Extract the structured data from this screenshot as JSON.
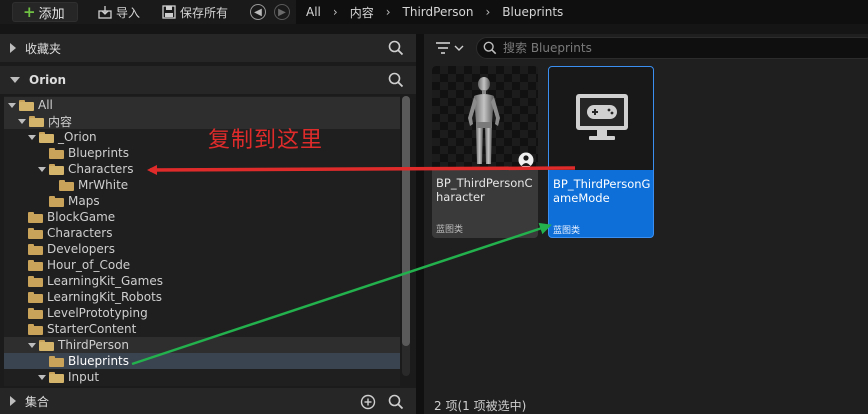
{
  "toolbar": {
    "add_label": "添加",
    "import_label": "导入",
    "save_all_label": "保存所有"
  },
  "breadcrumb": [
    "All",
    "内容",
    "ThirdPerson",
    "Blueprints"
  ],
  "left_panel": {
    "favorites_label": "收藏夹",
    "project_label": "Orion",
    "collections_label": "集合",
    "tree": [
      {
        "label": "All",
        "depth": 0,
        "expanded": true,
        "state": "parent"
      },
      {
        "label": "内容",
        "depth": 1,
        "expanded": true,
        "state": "parent"
      },
      {
        "label": "_Orion",
        "depth": 2,
        "expanded": true,
        "state": ""
      },
      {
        "label": "Blueprints",
        "depth": 3,
        "expanded": false,
        "leaf": true,
        "state": ""
      },
      {
        "label": "Characters",
        "depth": 3,
        "expanded": true,
        "state": ""
      },
      {
        "label": "MrWhite",
        "depth": 4,
        "expanded": false,
        "leaf": true,
        "state": ""
      },
      {
        "label": "Maps",
        "depth": 3,
        "expanded": false,
        "leaf": true,
        "state": ""
      },
      {
        "label": "BlockGame",
        "depth": 2,
        "expanded": false,
        "state": ""
      },
      {
        "label": "Characters",
        "depth": 2,
        "expanded": false,
        "state": ""
      },
      {
        "label": "Developers",
        "depth": 2,
        "expanded": false,
        "state": ""
      },
      {
        "label": "Hour_of_Code",
        "depth": 2,
        "expanded": false,
        "state": ""
      },
      {
        "label": "LearningKit_Games",
        "depth": 2,
        "expanded": false,
        "state": ""
      },
      {
        "label": "LearningKit_Robots",
        "depth": 2,
        "expanded": false,
        "state": ""
      },
      {
        "label": "LevelPrototyping",
        "depth": 2,
        "expanded": false,
        "state": ""
      },
      {
        "label": "StarterContent",
        "depth": 2,
        "expanded": false,
        "state": ""
      },
      {
        "label": "ThirdPerson",
        "depth": 2,
        "expanded": true,
        "state": "parent"
      },
      {
        "label": "Blueprints",
        "depth": 3,
        "expanded": false,
        "leaf": true,
        "state": "selected"
      },
      {
        "label": "Input",
        "depth": 3,
        "expanded": true,
        "state": ""
      }
    ]
  },
  "right_panel": {
    "search_placeholder": "搜索 Blueprints",
    "assets": [
      {
        "name": "BP_ThirdPersonCharacter",
        "type": "蓝图类",
        "selected": false
      },
      {
        "name": "BP_ThirdPersonGameMode",
        "type": "蓝图类",
        "selected": true
      }
    ],
    "status": "2 项(1 项被选中)"
  },
  "annotation": {
    "text": "复制到这里",
    "red_color": "#e02b2b",
    "green_color": "#23b14d"
  }
}
